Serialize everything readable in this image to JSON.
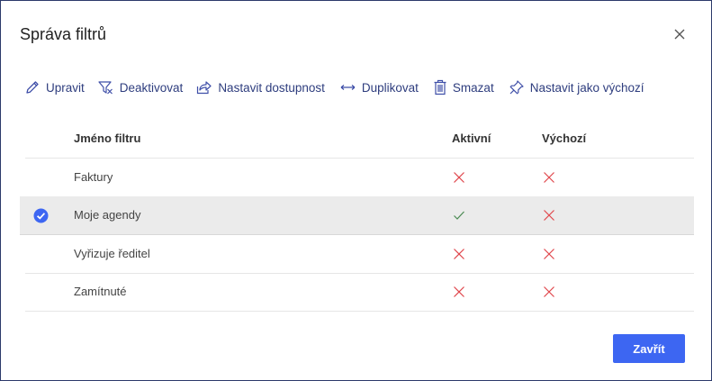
{
  "dialog": {
    "title": "Správa filtrů",
    "close_icon": "close-icon"
  },
  "toolbar": {
    "items": [
      {
        "label": "Upravit",
        "icon": "pencil-icon"
      },
      {
        "label": "Deaktivovat",
        "icon": "filter-off-icon"
      },
      {
        "label": "Nastavit dostupnost",
        "icon": "share-icon"
      },
      {
        "label": "Duplikovat",
        "icon": "arrows-horizontal-icon"
      },
      {
        "label": "Smazat",
        "icon": "trash-icon"
      },
      {
        "label": "Nastavit jako výchozí",
        "icon": "pin-icon"
      }
    ]
  },
  "table": {
    "columns": {
      "name": "Jméno filtru",
      "active": "Aktivní",
      "default": "Výchozí"
    },
    "rows": [
      {
        "name": "Faktury",
        "active": false,
        "default": false,
        "selected": false
      },
      {
        "name": "Moje agendy",
        "active": true,
        "default": false,
        "selected": true
      },
      {
        "name": "Vyřizuje ředitel",
        "active": false,
        "default": false,
        "selected": false
      },
      {
        "name": "Zamítnuté",
        "active": false,
        "default": false,
        "selected": false
      }
    ]
  },
  "footer": {
    "close_label": "Zavřít"
  },
  "colors": {
    "accent": "#3d66f2",
    "toolbar_text": "#2e3d7e",
    "cross": "#e0454b",
    "check": "#4a8a52"
  }
}
